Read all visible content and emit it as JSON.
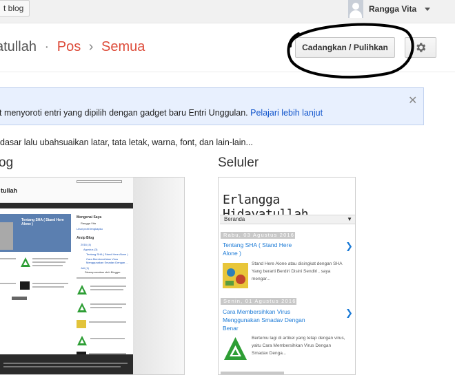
{
  "topbar": {
    "view_blog_label": "t blog",
    "user_name": "Rangga Vita"
  },
  "header": {
    "blog_name": "yatullah",
    "separator_dot": "·",
    "crumb_pos": "Pos",
    "separator_arrow": "›",
    "crumb_all": "Semua",
    "backup_button": "Cadangkan / Pulihkan",
    "settings_icon": "gear-icon"
  },
  "notice": {
    "text": "t menyoroti entri yang dipilih dengan gadget baru Entri Unggulan. ",
    "link": "Pelajari lebih lanjut",
    "close_icon": "close-icon"
  },
  "description": "dasar lalu ubahsuaikan latar, tata letak, warna, font, dan lain-lain...",
  "sections": {
    "blog_label": "og",
    "mobile_label": "Seluler"
  },
  "desktop_preview": {
    "blog_title": "tullah",
    "post_title": "Tentang SHA ( Stand Here Alone )",
    "sidebar_title": "Mengenai Saya",
    "sidebar_user": "Rangga Vita",
    "sidebar_profile_link": "Lihat profil lengkapku",
    "archive_title": "Arsip Blog",
    "archive_items": [
      "2016 (4)",
      "Agustus (3)",
      "Tentang SHA ( Stand Here Alone )",
      "Cara Membersihkan Virus Menggunakan Smadav Dengan ...",
      "Juli (1)"
    ],
    "powered_by": "Disempurnakan oleh Blogger."
  },
  "mobile_preview": {
    "blog_title": "Erlangga Hidayatullah",
    "nav_label": "Beranda",
    "posts": [
      {
        "date": "Rabu, 03 Agustus 2016",
        "title": "Tentang SHA ( Stand Here Alone )",
        "snippet": "Stand Here Alone atau disingkat dengan SHA Yang berarti Berdiri Disini Sendiri , saya mengar..."
      },
      {
        "date": "Senin, 01 Agustus 2016",
        "title": "Cara Membersihkan Virus Menggunakan Smadav Dengan Benar",
        "snippet": "Bertemu lagi di artikel yang tetap dengan virus, yaitu Cara Membersihkan Virus Dengan Smadav Denga..."
      }
    ]
  },
  "colors": {
    "accent": "#dd4b39",
    "link": "#1155cc",
    "notice_bg": "#e8f0fe",
    "mobile_link": "#1b7ad6"
  }
}
